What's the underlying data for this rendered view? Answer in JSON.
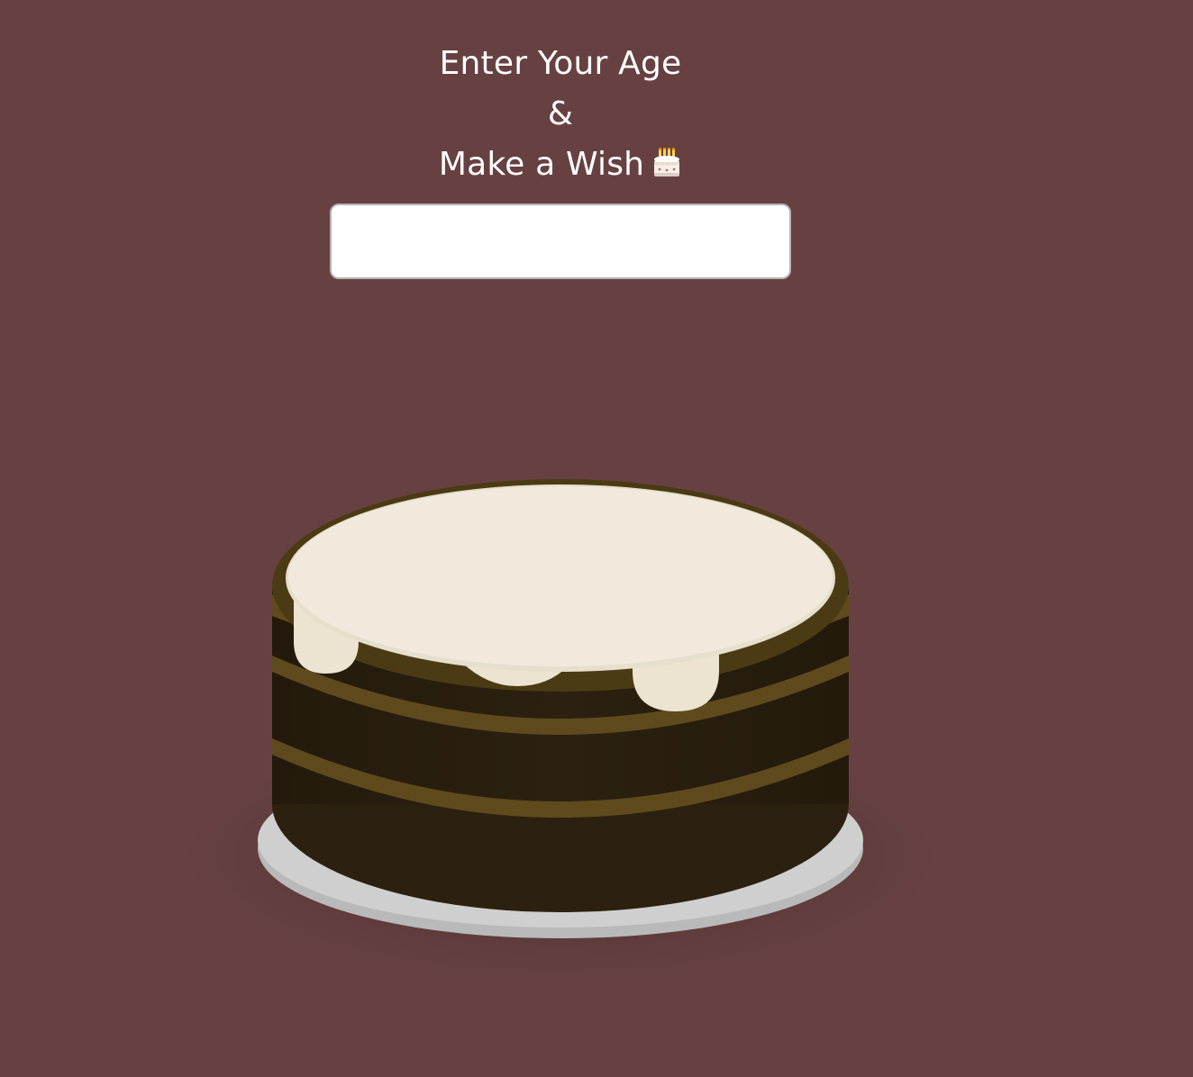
{
  "page": {
    "background_color": "#674141",
    "heading": {
      "line1": "Enter Your Age",
      "line2": "&",
      "line3": "Make a Wish",
      "emoji_icon": "birthday-cake-icon"
    },
    "age_input": {
      "value": "",
      "placeholder": ""
    },
    "cake": {
      "plate_color": "#cfcfcf",
      "sponge_color": "#2c2110",
      "filling_color": "#5e4a1d",
      "frosting_color": "#f1eadc"
    }
  }
}
